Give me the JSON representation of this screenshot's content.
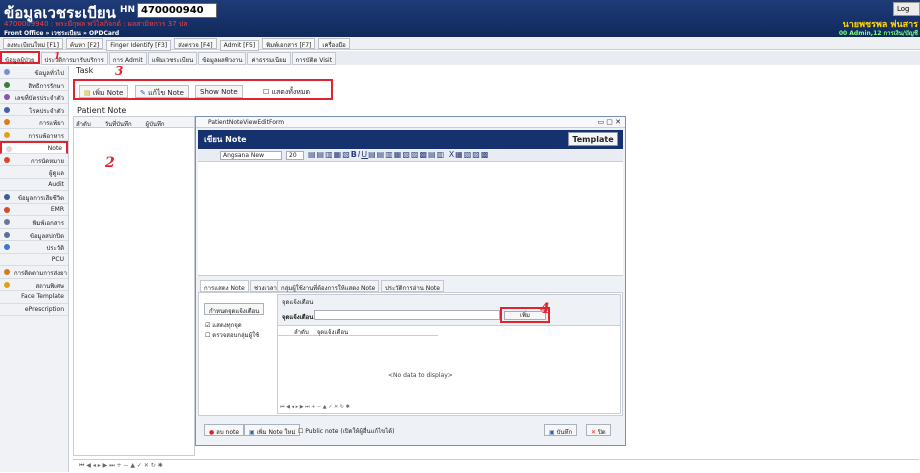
{
  "header": {
    "title": "ข้อมูลเวชระเบียน",
    "hn_label": "HN",
    "hn_value": "470000940",
    "subtitle": "4700009940 : พระมีกุพล พวิไลกิจกต์ : ผลสามิหการ 37 ปล",
    "path": "Front Office » เวชระเบียน » OPDCard",
    "log_label": "Log",
    "user_name": "นายพชรพล พ่นสาร",
    "user_info": "00 Admin,12 การเงิน/บัญชี"
  },
  "toolbar": [
    {
      "label": "ลงทะเบียนใหม่ [F1]"
    },
    {
      "label": "ค้นหา [F2]"
    },
    {
      "label": "Finger Identify [F3]"
    },
    {
      "label": "ส่งตรวจ [F4]"
    },
    {
      "label": "Admit [F5]"
    },
    {
      "label": "พิมพ์เอกสาร [F7]"
    },
    {
      "label": "เครื่องมือ"
    }
  ],
  "tabs": [
    {
      "label": "ข้อมูลผู้ป่วย"
    },
    {
      "label": "ประวัติการมารับบริการ"
    },
    {
      "label": "การ Admit"
    },
    {
      "label": "แฟ้มเวชระเบียน"
    },
    {
      "label": "ข้อมูลผลพิวงาน"
    },
    {
      "label": "ค่าธรรมเนียม"
    },
    {
      "label": "การบัติต Visit"
    }
  ],
  "sidebar": [
    {
      "label": "ข้อมูลทั่วไป",
      "color": "#7b8ed0"
    },
    {
      "label": "สิทธิการรักษา",
      "color": "#3b7d3b"
    },
    {
      "label": "เลขที่บัตรประจำตัว",
      "color": "#8a55a5"
    },
    {
      "label": "โรคประจำตัว",
      "color": "#3f5fb0"
    },
    {
      "label": "การแพ้ยา",
      "color": "#e07a1a"
    },
    {
      "label": "การแพ้อาหาร",
      "color": "#e0a11a"
    },
    {
      "label": "Note",
      "color": "#d8d8d8"
    },
    {
      "label": "การนัดหมาย",
      "color": "#d9482b"
    },
    {
      "label": "ผู้ดูแล",
      "color": "#f0f2f6"
    },
    {
      "label": "Audit",
      "color": "#f0f2f6"
    },
    {
      "label": "ข้อมูลการเสียชีวิต",
      "color": "#3b5e9b"
    },
    {
      "label": "EMR",
      "color": "#d9482b"
    },
    {
      "label": "พิมพ์เอกสาร",
      "color": "#6b7a93"
    },
    {
      "label": "ข้อมูลสปกปิด",
      "color": "#5a6ea0"
    },
    {
      "label": "ประวัติ",
      "color": "#3f78c8"
    },
    {
      "label": "PCU",
      "color": "#f0f2f6"
    },
    {
      "label": "การติดตามการส่งยา",
      "color": "#d67b1a"
    },
    {
      "label": "สถานพิเศษ",
      "color": "#e0a11a"
    },
    {
      "label": "Face Template",
      "color": "#f0f2f6"
    },
    {
      "label": "ePrescription",
      "color": "#f0f2f6"
    }
  ],
  "task": {
    "label": "Task",
    "add_note": "เพิ่ม Note",
    "edit_note": "แก้ไข Note",
    "show_note": "Show Note",
    "show_all": "แสดงทั้งหมด"
  },
  "patient_note": {
    "label": "Patient Note",
    "col_order": "ลำดับ",
    "col_date": "วันที่บันทึก",
    "col_user": "ผู้บันทึก"
  },
  "dialog": {
    "window_title": "PatientNoteViewEditForm",
    "head_title": "เขียน Note",
    "template_btn": "Template",
    "font_name": "Angsana New",
    "font_size": "20",
    "tabs": [
      {
        "label": "การแสดง Note"
      },
      {
        "label": "ช่วงเวลา"
      },
      {
        "label": "กลุ่มผู้ใช้งานที่ต้องการให้แสดง Note"
      },
      {
        "label": "ประวัติการอ่าน Note"
      }
    ],
    "set_alert_btn": "กำหนดจุดแจ้งเตือน",
    "check_show_all": "แสดงทุกจุด",
    "check_verify": "ตรวจสอบกลุ่มผู้ใช้",
    "alert_group": "จุดแจ้งเตือน",
    "alert_field_label": "จุดแจ้งเตือน",
    "add_btn": "เพิ่ม",
    "grid_col_order": "ลำดับ",
    "grid_col_point": "จุดแจ้งเตือน",
    "no_data": "<No data to display>",
    "delete_btn": "ลบ note",
    "new_note_btn": "เพิ่ม Note ใหม่",
    "public_note": "Public note (เปิดให้ผู้อื่นแก้ไขได้)",
    "save_btn": "บันทึก",
    "close_btn": "ปิด"
  },
  "annotations": {
    "a1": "1",
    "a2": "2",
    "a3": "3",
    "a4": "4"
  }
}
